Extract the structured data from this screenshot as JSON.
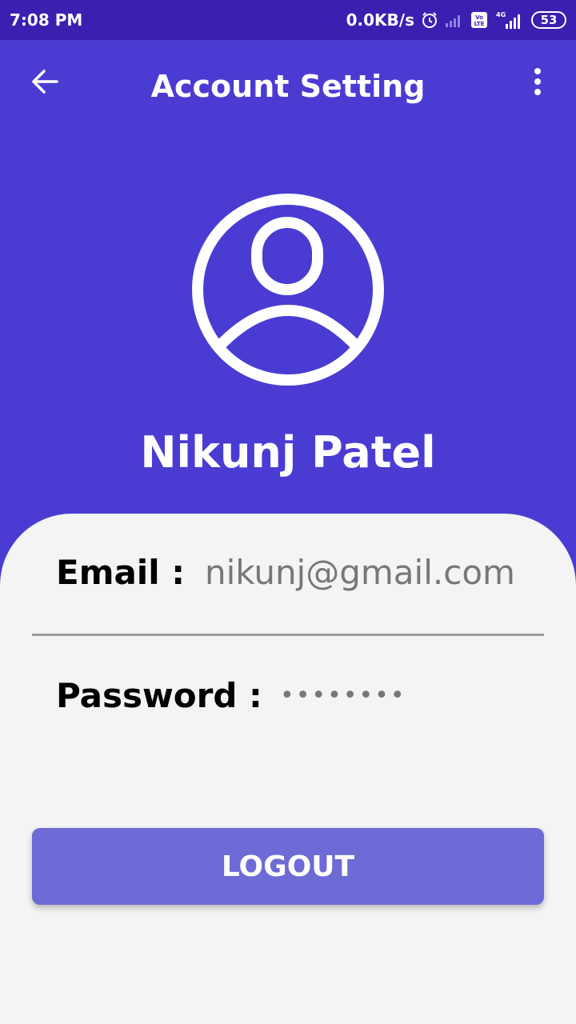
{
  "status_bar": {
    "time": "7:08 PM",
    "speed": "0.0KB/s",
    "network": "4G",
    "battery": "53",
    "icons": [
      "alarm-icon",
      "signal-icon",
      "volte-icon",
      "signal-4g-icon",
      "battery-icon"
    ]
  },
  "app_bar": {
    "title": "Account Setting",
    "back_icon": "arrow-back-icon",
    "more_icon": "more-vert-icon"
  },
  "profile": {
    "name": "Nikunj Patel",
    "avatar_icon": "account-circle-icon"
  },
  "account": {
    "email_label": "Email :",
    "email_value": "nikunj@gmail.com",
    "password_label": "Password :",
    "password_value": "••••••••"
  },
  "actions": {
    "logout_label": "LOGOUT"
  },
  "colors": {
    "status_bar": "#3a1fb0",
    "primary": "#4a3cd2",
    "card_background": "#f4f4f4",
    "button": "#6e6ad6"
  }
}
